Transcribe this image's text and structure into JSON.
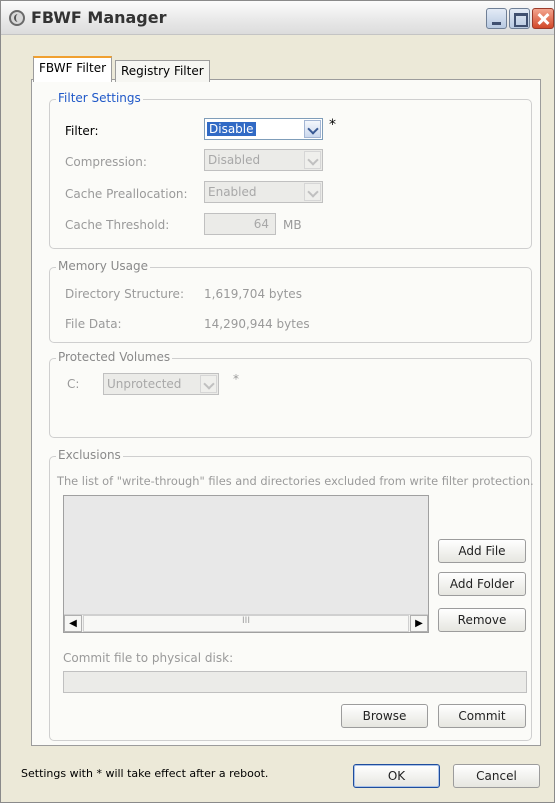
{
  "window": {
    "title": "FBWF Manager"
  },
  "tabs": [
    {
      "label": "FBWF Filter",
      "active": true
    },
    {
      "label": "Registry Filter",
      "active": false
    }
  ],
  "filter_settings": {
    "group_title": "Filter Settings",
    "filter": {
      "label": "Filter:",
      "value": "Disable",
      "asterisk": "*"
    },
    "compression": {
      "label": "Compression:",
      "value": "Disabled"
    },
    "cache_preallocation": {
      "label": "Cache Preallocation:",
      "value": "Enabled"
    },
    "cache_threshold": {
      "label": "Cache Threshold:",
      "value": "64",
      "unit": "MB"
    }
  },
  "memory_usage": {
    "group_title": "Memory Usage",
    "directory_structure": {
      "label": "Directory Structure:",
      "value": "1,619,704 bytes"
    },
    "file_data": {
      "label": "File Data:",
      "value": "14,290,944 bytes"
    }
  },
  "protected_volumes": {
    "group_title": "Protected Volumes",
    "drive_label": "C:",
    "state": "Unprotected",
    "asterisk": "*"
  },
  "exclusions": {
    "group_title": "Exclusions",
    "description": "The list of \"write-through\" files and directories excluded from write filter protection.",
    "scroll_grip": "III",
    "add_file": "Add File",
    "add_folder": "Add Folder",
    "remove": "Remove",
    "commit_label": "Commit file to physical disk:",
    "commit_path": "",
    "browse": "Browse",
    "commit": "Commit"
  },
  "footer": {
    "note": "Settings with * will take effect after a reboot.",
    "ok": "OK",
    "cancel": "Cancel"
  }
}
